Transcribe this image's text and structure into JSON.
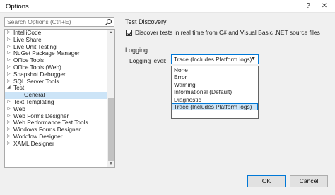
{
  "window": {
    "title": "Options",
    "help_glyph": "?",
    "close_glyph": "✕"
  },
  "search": {
    "placeholder": "Search Options (Ctrl+E)"
  },
  "tree": {
    "items": [
      {
        "label": "IntelliCode",
        "expanded": false,
        "child": false,
        "selected": false
      },
      {
        "label": "Live Share",
        "expanded": false,
        "child": false,
        "selected": false
      },
      {
        "label": "Live Unit Testing",
        "expanded": false,
        "child": false,
        "selected": false
      },
      {
        "label": "NuGet Package Manager",
        "expanded": false,
        "child": false,
        "selected": false
      },
      {
        "label": "Office Tools",
        "expanded": false,
        "child": false,
        "selected": false
      },
      {
        "label": "Office Tools (Web)",
        "expanded": false,
        "child": false,
        "selected": false
      },
      {
        "label": "Snapshot Debugger",
        "expanded": false,
        "child": false,
        "selected": false
      },
      {
        "label": "SQL Server Tools",
        "expanded": false,
        "child": false,
        "selected": false
      },
      {
        "label": "Test",
        "expanded": true,
        "child": false,
        "selected": false
      },
      {
        "label": "General",
        "expanded": false,
        "child": true,
        "selected": true
      },
      {
        "label": "Text Templating",
        "expanded": false,
        "child": false,
        "selected": false
      },
      {
        "label": "Web",
        "expanded": false,
        "child": false,
        "selected": false
      },
      {
        "label": "Web Forms Designer",
        "expanded": false,
        "child": false,
        "selected": false
      },
      {
        "label": "Web Performance Test Tools",
        "expanded": false,
        "child": false,
        "selected": false
      },
      {
        "label": "Windows Forms Designer",
        "expanded": false,
        "child": false,
        "selected": false
      },
      {
        "label": "Workflow Designer",
        "expanded": false,
        "child": false,
        "selected": false
      },
      {
        "label": "XAML Designer",
        "expanded": false,
        "child": false,
        "selected": false
      }
    ]
  },
  "test_discovery": {
    "heading": "Test Discovery",
    "checkbox_label": "Discover tests in real time from C# and Visual Basic .NET source files",
    "checked": true
  },
  "logging": {
    "heading": "Logging",
    "level_label": "Logging level:",
    "selected_value": "Trace (Includes Platform logs)",
    "options": [
      "None",
      "Error",
      "Warning",
      "Informational (Default)",
      "Diagnostic",
      "Trace (Includes Platform logs)"
    ],
    "selected_index": 5
  },
  "footer": {
    "ok_label": "OK",
    "cancel_label": "Cancel"
  },
  "colors": {
    "accent": "#0078d7",
    "selection": "#cce4f7"
  }
}
